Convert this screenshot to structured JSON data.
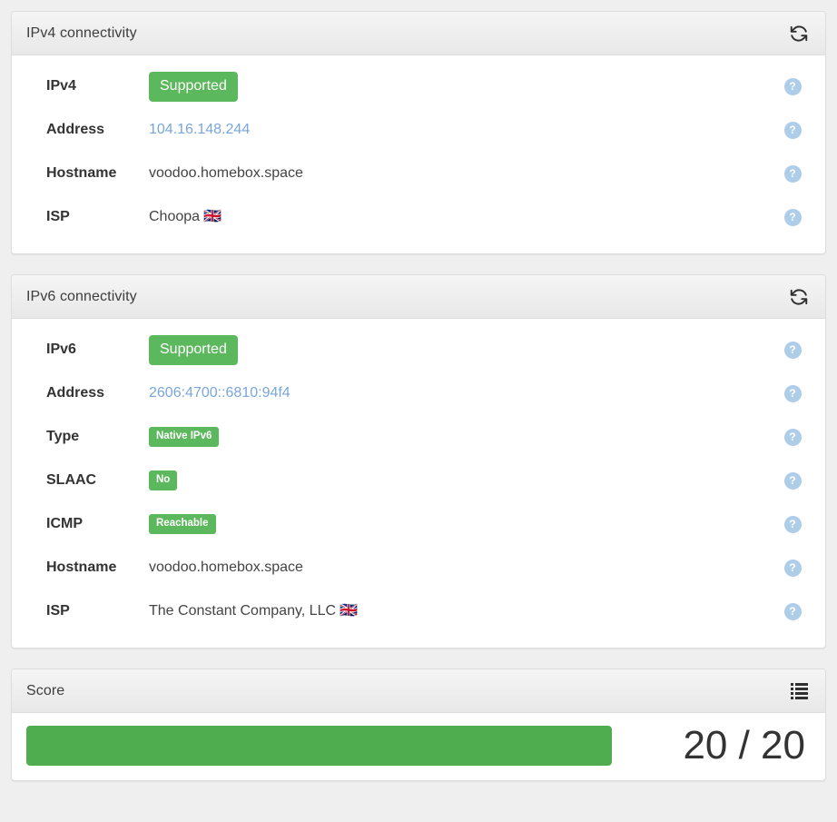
{
  "ipv4_panel": {
    "title": "IPv4 connectivity",
    "refresh_icon": "refresh-icon",
    "rows": [
      {
        "label": "IPv4",
        "value": "Supported",
        "kind": "badge-lg",
        "help": "?"
      },
      {
        "label": "Address",
        "value": "104.16.148.244",
        "kind": "link",
        "help": "?"
      },
      {
        "label": "Hostname",
        "value": "voodoo.homebox.space",
        "kind": "text",
        "help": "?"
      },
      {
        "label": "ISP",
        "value": "Choopa",
        "kind": "text-flag",
        "flag": "🇬🇧",
        "help": "?"
      }
    ]
  },
  "ipv6_panel": {
    "title": "IPv6 connectivity",
    "refresh_icon": "refresh-icon",
    "rows": [
      {
        "label": "IPv6",
        "value": "Supported",
        "kind": "badge-lg",
        "help": "?"
      },
      {
        "label": "Address",
        "value": "2606:4700::6810:94f4",
        "kind": "link",
        "help": "?"
      },
      {
        "label": "Type",
        "value": "Native IPv6",
        "kind": "badge-sm",
        "help": "?"
      },
      {
        "label": "SLAAC",
        "value": "No",
        "kind": "badge-sm",
        "help": "?"
      },
      {
        "label": "ICMP",
        "value": "Reachable",
        "kind": "badge-sm",
        "help": "?"
      },
      {
        "label": "Hostname",
        "value": "voodoo.homebox.space",
        "kind": "text",
        "help": "?"
      },
      {
        "label": "ISP",
        "value": "The Constant Company, LLC",
        "kind": "text-flag",
        "flag": "🇬🇧",
        "help": "?"
      }
    ]
  },
  "score_panel": {
    "title": "Score",
    "list_icon": "list-icon",
    "value": 20,
    "max": 20,
    "percent": 100,
    "display": "20 / 20"
  },
  "colors": {
    "success_green": "#5cb85c",
    "progress_green": "#4fad4f",
    "link_blue": "#79a6dc",
    "help_blue": "#aecde8",
    "page_background": "#efefef",
    "panel_border": "#dddddd"
  }
}
